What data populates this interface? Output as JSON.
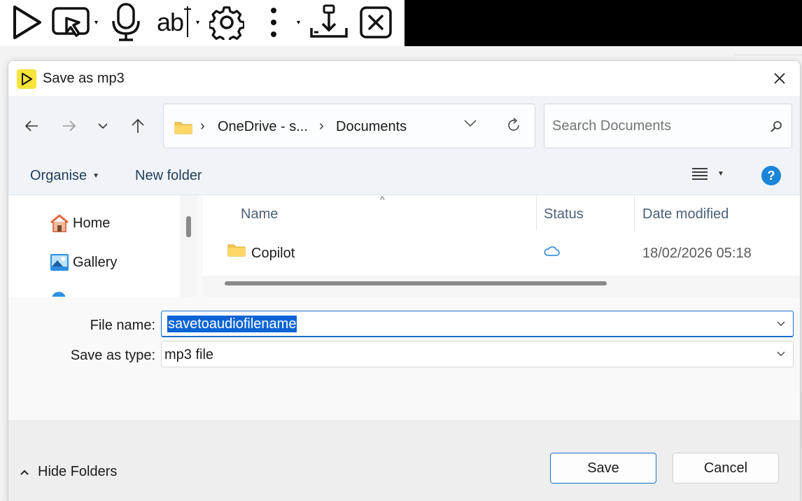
{
  "toolbar": {
    "items": [
      "play-icon",
      "select-pointer-icon",
      "microphone-icon",
      "text-cursor-icon",
      "gear-icon",
      "more-vertical-icon",
      "download-tray-icon",
      "close-box-icon"
    ],
    "text_tool_label": "ab"
  },
  "dialog": {
    "title": "Save as mp3",
    "title_icon": "play-icon",
    "accent_color": "#f6e33b"
  },
  "address": {
    "segments": [
      "OneDrive - s...",
      "Documents"
    ]
  },
  "search": {
    "placeholder": "Search Documents"
  },
  "commands": {
    "organise_label": "Organise",
    "new_folder_label": "New folder",
    "help_label": "?"
  },
  "nav_pane": {
    "items": [
      {
        "label": "Home",
        "icon": "home-icon"
      },
      {
        "label": "Gallery",
        "icon": "gallery-icon"
      }
    ]
  },
  "file_list": {
    "columns": [
      "Name",
      "Status",
      "Date modified"
    ],
    "rows": [
      {
        "name": "Copilot",
        "icon": "folder-icon",
        "status": "cloud-icon",
        "date_modified": "18/02/2026 05:18"
      }
    ]
  },
  "fields": {
    "file_name_label": "File name:",
    "file_name_value": "savetoaudiofilename",
    "save_type_label": "Save as type:",
    "save_type_value": "mp3 file"
  },
  "footer": {
    "hide_folders_label": "Hide Folders",
    "save_label": "Save",
    "cancel_label": "Cancel"
  },
  "colors": {
    "primary_blue": "#1a6fc9",
    "selection_blue": "#0a64d6",
    "help_blue": "#1b84d9",
    "nav_bg": "#f0f4f9"
  }
}
